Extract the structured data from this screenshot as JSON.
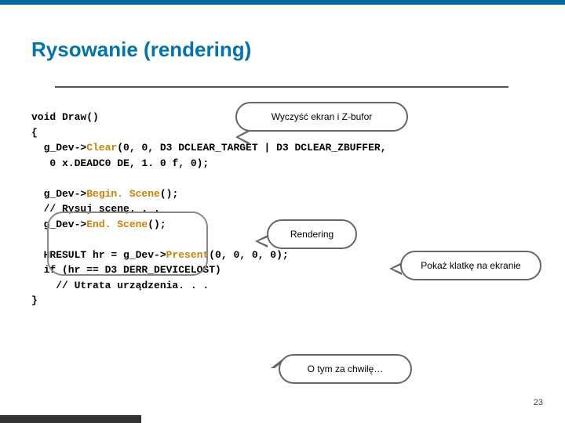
{
  "title": "Rysowanie (rendering)",
  "page_number": "23",
  "callouts": {
    "clear": "Wyczyść ekran i Z-bufor",
    "render": "Rendering",
    "show": "Pokaż klatkę na ekranie",
    "later": "O tym za chwilę…"
  },
  "code": {
    "l1a": "void Draw()",
    "l1b": "{",
    "l2a": "  g_Dev->",
    "l2hl": "Clear",
    "l2b": "(0, 0, D3 DCLEAR_TARGET | D3 DCLEAR_ZBUFFER,",
    "l3": "   0 x.DEADC0 DE, 1. 0 f, 0);",
    "gap1": " ",
    "l4a": "  g_Dev->",
    "l4hl": "Begin. Scene",
    "l4b": "();",
    "l5": "  // Rysuj scenę. . .",
    "l6a": "  g_Dev->",
    "l6hl": "End. Scene",
    "l6b": "();",
    "gap2": " ",
    "l7a": "  HRESULT hr = g_Dev->",
    "l7hl": "Present",
    "l7b": "(0, 0, 0, 0);",
    "l8": "  if (hr == D3 DERR_DEVICELOST)",
    "l9": "    // Utrata urządzenia. . .",
    "l10": "}"
  }
}
